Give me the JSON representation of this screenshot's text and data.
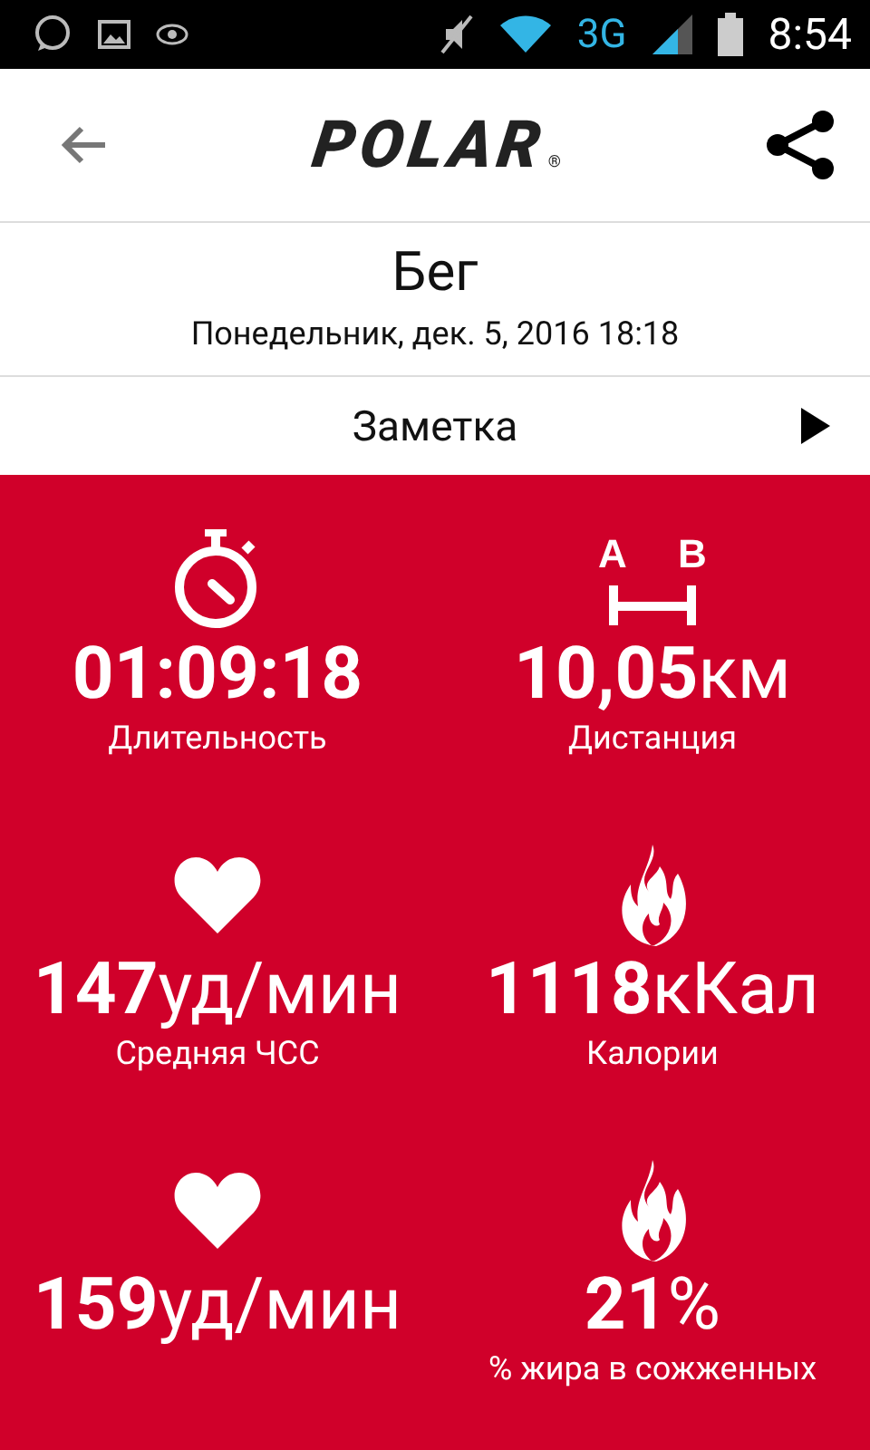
{
  "status_bar": {
    "network": "3G",
    "time": "8:54"
  },
  "header": {
    "logo": "POLAR",
    "logo_mark": "®"
  },
  "workout": {
    "title": "Бег",
    "date": "Понедельник, дек. 5, 2016 18:18"
  },
  "note": {
    "label": "Заметка"
  },
  "distance_marker_letters": [
    "A",
    "B"
  ],
  "stats": [
    {
      "kind": "stopwatch",
      "value": "01:09:18",
      "label": "Длительность"
    },
    {
      "kind": "distance",
      "value": "10,05",
      "unit": "км",
      "label": "Дистанция"
    },
    {
      "kind": "heart",
      "value": "147",
      "unit": "уд/мин",
      "label": "Средняя ЧСС"
    },
    {
      "kind": "flame",
      "value": "1118",
      "unit": "кКал",
      "label": "Калории"
    },
    {
      "kind": "heart",
      "value": "159",
      "unit": "уд/мин"
    },
    {
      "kind": "flame",
      "value": "21",
      "unit": "%",
      "label": "% жира в сожженных"
    }
  ]
}
